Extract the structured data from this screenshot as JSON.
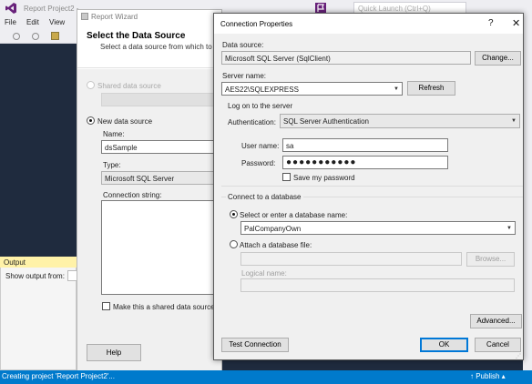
{
  "vs": {
    "title": "Report Project2 - ",
    "quick_launch_placeholder": "Quick Launch (Ctrl+Q)",
    "menu": [
      "File",
      "Edit",
      "View"
    ],
    "output_title": "Output",
    "output_show_from": "Show output from:",
    "status_text": "Creating project 'Report Project2'...",
    "publish": "↑ Publish ▴"
  },
  "wizard": {
    "title": "Report Wizard",
    "heading": "Select the Data Source",
    "subheading": "Select a data source from which to ol",
    "shared_data_source_label": "Shared data source",
    "new_data_source_label": "New data source",
    "name_label": "Name:",
    "name_value": "dsSample",
    "type_label": "Type:",
    "type_value": "Microsoft SQL Server",
    "connection_string_label": "Connection string:",
    "shared_checkbox_label": "Make this a shared data source",
    "help_button": "Help"
  },
  "conn": {
    "title": "Connection Properties",
    "help_glyph": "?",
    "close_glyph": "✕",
    "data_source_label": "Data source:",
    "data_source_value": "Microsoft SQL Server (SqlClient)",
    "change_button": "Change...",
    "server_name_label": "Server name:",
    "server_name_value": "AES22\\SQLEXPRESS",
    "refresh_button": "Refresh",
    "logon_group_label": "Log on to the server",
    "auth_label": "Authentication:",
    "auth_value": "SQL Server Authentication",
    "user_label": "User name:",
    "user_value": "sa",
    "password_label": "Password:",
    "password_mask": "●●●●●●●●●●●",
    "save_password_label": "Save my password",
    "db_group_label": "Connect to a database",
    "select_db_label": "Select or enter a database name:",
    "db_value": "PalCompanyOwn",
    "attach_label": "Attach a database file:",
    "browse_button": "Browse...",
    "logical_name_label": "Logical name:",
    "advanced_button": "Advanced...",
    "test_button": "Test Connection",
    "ok_button": "OK",
    "cancel_button": "Cancel",
    "dropdown_glyph": "▼"
  },
  "colors": {
    "vs_background": "#1f2b3e",
    "statusbar": "#007acc",
    "output_title": "#fff2a8",
    "dialog_face": "#f0f0f0",
    "accent_border": "#0078d7"
  }
}
